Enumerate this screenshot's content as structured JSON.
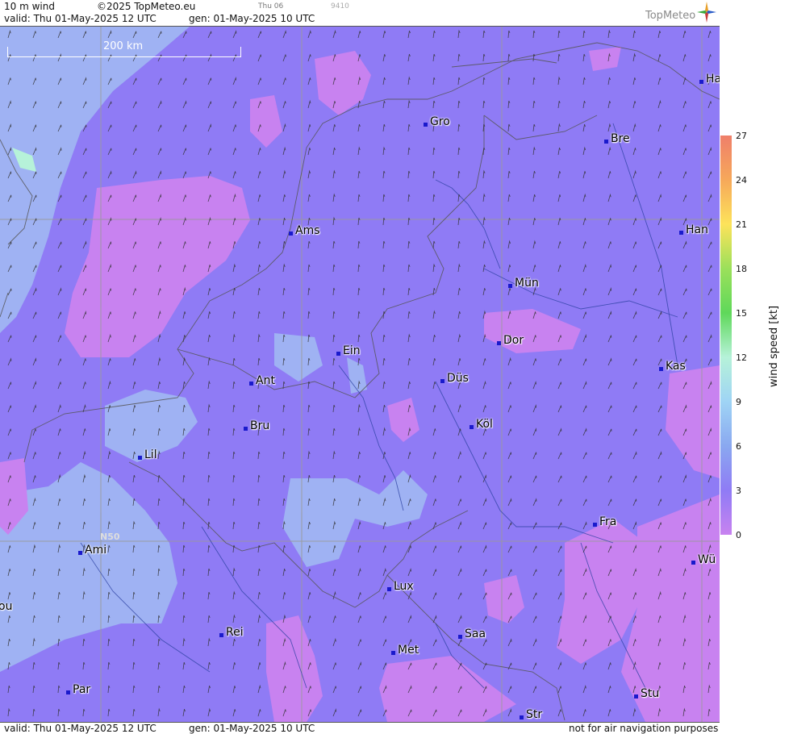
{
  "header": {
    "product": "10 m wind",
    "copyright": "©2025 TopMeteo.eu",
    "small_time": "Thu 06",
    "small_code": "9410",
    "valid_label": "valid:  Thu  01-May-2025  12 UTC",
    "gen_label": "gen: 01-May-2025 10 UTC",
    "logo_text": "TopMeteo"
  },
  "footer": {
    "valid_label": "valid:  Thu  01-May-2025  12 UTC",
    "gen_label": "gen: 01-May-2025 10 UTC",
    "disclaimer": "not for air navigation purposes"
  },
  "map": {
    "scale_label": "200 km",
    "grid_label": "N50",
    "cities": [
      {
        "name": "Ha"
      },
      {
        "name": "Gro"
      },
      {
        "name": "Bre"
      },
      {
        "name": "Han"
      },
      {
        "name": "Ams"
      },
      {
        "name": "Mün"
      },
      {
        "name": "Dor"
      },
      {
        "name": "Ein"
      },
      {
        "name": "Kas"
      },
      {
        "name": "Ant"
      },
      {
        "name": "Düs"
      },
      {
        "name": "Köl"
      },
      {
        "name": "Bru"
      },
      {
        "name": "Lil"
      },
      {
        "name": "Fra"
      },
      {
        "name": "Ami"
      },
      {
        "name": "Wü"
      },
      {
        "name": "Lux"
      },
      {
        "name": "ou"
      },
      {
        "name": "Rei"
      },
      {
        "name": "Saa"
      },
      {
        "name": "Met"
      },
      {
        "name": "Par"
      },
      {
        "name": "Stu"
      },
      {
        "name": "Str"
      }
    ]
  },
  "legend": {
    "title": "wind  speed  [kt]",
    "ticks": [
      "27",
      "24",
      "21",
      "18",
      "15",
      "12",
      "9",
      "6",
      "3",
      "0"
    ],
    "colors": [
      "#ef7f6a",
      "#f6a85a",
      "#fde35a",
      "#9be05a",
      "#5fd85a",
      "#b6f2d9",
      "#9fd4f5",
      "#8aa8f0",
      "#8f7bf5",
      "#c882f0"
    ]
  }
}
